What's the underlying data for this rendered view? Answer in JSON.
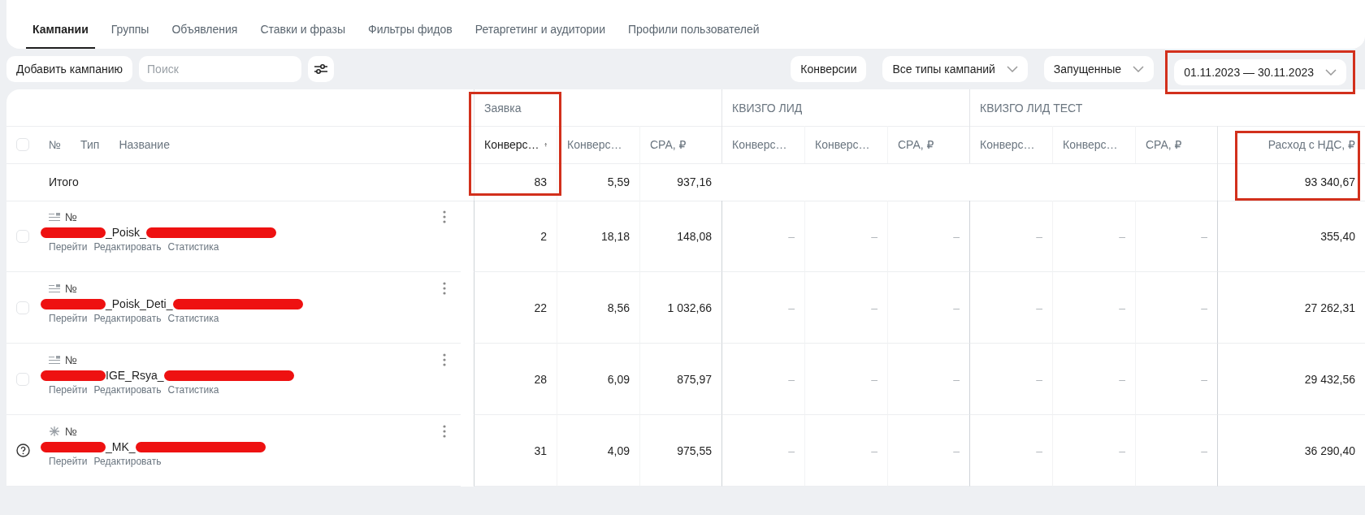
{
  "tabs": [
    {
      "label": "Кампании",
      "selected": true
    },
    {
      "label": "Группы",
      "selected": false
    },
    {
      "label": "Объявления",
      "selected": false
    },
    {
      "label": "Ставки и фразы",
      "selected": false
    },
    {
      "label": "Фильтры фидов",
      "selected": false
    },
    {
      "label": "Ретаргетинг и аудитории",
      "selected": false
    },
    {
      "label": "Профили пользователей",
      "selected": false
    }
  ],
  "toolbar": {
    "add_button": "Добавить кампанию",
    "search": {
      "placeholder": "Поиск"
    },
    "filters": [
      {
        "label": "Конверсии",
        "dropdown": false,
        "highlighted": false
      },
      {
        "label": "Все типы кампаний",
        "dropdown": true,
        "highlighted": false
      },
      {
        "label": "Запущенные",
        "dropdown": true,
        "highlighted": false
      },
      {
        "label": "01.11.2023 — 30.11.2023",
        "dropdown": true,
        "highlighted": true
      }
    ]
  },
  "table": {
    "header_checked": false,
    "name_headers": [
      "№",
      "Тип",
      "Название"
    ],
    "groups": [
      {
        "title": "Заявка",
        "highlighted": true
      },
      {
        "title": "КВИЗГО ЛИД",
        "highlighted": false
      },
      {
        "title": "КВИЗГО ЛИД ТЕСТ",
        "highlighted": false
      }
    ],
    "columns": [
      {
        "label": "Конверс…",
        "sorted": true
      },
      {
        "label": "Конверс…",
        "sorted": false
      },
      {
        "label": "CPA, ₽",
        "sorted": false
      },
      {
        "label": "Конверс…",
        "sorted": false
      },
      {
        "label": "Конверс…",
        "sorted": false
      },
      {
        "label": "CPA, ₽",
        "sorted": false
      },
      {
        "label": "Конверс…",
        "sorted": false
      },
      {
        "label": "Конверс…",
        "sorted": false
      },
      {
        "label": "CPA, ₽",
        "sorted": false
      }
    ],
    "spend_column": {
      "label": "Расход с НДС, ₽",
      "highlighted": true
    },
    "total": {
      "label": "Итого",
      "cells": [
        "83",
        "5,59",
        "937,16"
      ],
      "spend": "93 340,67"
    },
    "rows": [
      {
        "kind": "text",
        "checked": false,
        "number_label": "№",
        "name": "_Poisk_",
        "actions": [
          "Перейти",
          "Редактировать",
          "Статистика"
        ],
        "cells": [
          "2",
          "18,18",
          "148,08",
          "–",
          "–",
          "–",
          "–",
          "–",
          "–"
        ],
        "spend": "355,40"
      },
      {
        "kind": "text",
        "checked": false,
        "number_label": "№",
        "name": "_Poisk_Deti_",
        "actions": [
          "Перейти",
          "Редактировать",
          "Статистика"
        ],
        "cells": [
          "22",
          "8,56",
          "1 032,66",
          "–",
          "–",
          "–",
          "–",
          "–",
          "–"
        ],
        "spend": "27 262,31"
      },
      {
        "kind": "text",
        "checked": false,
        "number_label": "№",
        "name": "IGE_Rsya_",
        "actions": [
          "Перейти",
          "Редактировать",
          "Статистика"
        ],
        "cells": [
          "28",
          "6,09",
          "875,97",
          "–",
          "–",
          "–",
          "–",
          "–",
          "–"
        ],
        "spend": "29 432,56"
      },
      {
        "kind": "auto",
        "number_label": "№",
        "name": "_MK_",
        "actions": [
          "Перейти",
          "Редактировать"
        ],
        "cells": [
          "31",
          "4,09",
          "975,55",
          "–",
          "–",
          "–",
          "–",
          "–",
          "–"
        ],
        "spend": "36 290,40"
      }
    ]
  }
}
